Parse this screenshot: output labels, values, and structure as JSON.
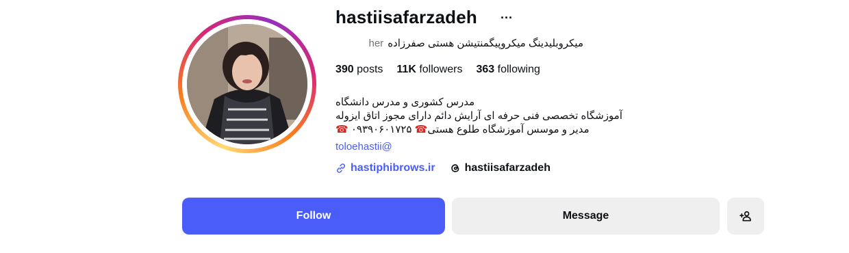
{
  "profile": {
    "username": "hastiisafarzadeh",
    "more_icon": "···",
    "full_name": "میکروبلیدینگ میکروپیگمنتیشن هستی صفرزاده",
    "pronouns": "her",
    "stats": {
      "posts_count": "390",
      "posts_label": "posts",
      "followers_count": "11K",
      "followers_label": "followers",
      "following_count": "363",
      "following_label": "following"
    },
    "bio": {
      "line1": "مدرس کشوری و مدرس دانشگاه",
      "line2": "آموزشگاه تخصصی فنی حرفه ای آرایش دائم دارای مجوز اتاق ایزوله",
      "line3_text": "مدیر و موسس آموزشگاه طلوع هستی",
      "phone": "۰۹۳۹۰۶۰۱۷۲۵",
      "phone_icon": "☎",
      "mention": "toloehastii@"
    },
    "links": {
      "website": "hastiphibrows.ir",
      "threads": "hastiisafarzadeh"
    }
  },
  "actions": {
    "follow_label": "Follow",
    "message_label": "Message"
  },
  "colors": {
    "accent": "#4a5df9",
    "button_gray": "#efefef",
    "phone_red": "#d6261f"
  }
}
